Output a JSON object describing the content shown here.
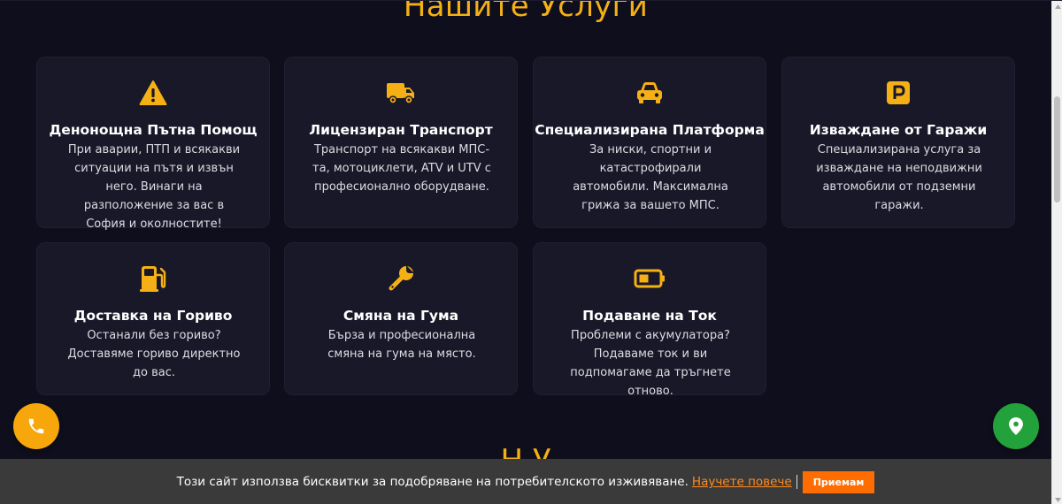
{
  "services": {
    "heading": "Нашите Услуги",
    "cards": [
      {
        "icon": "warning-triangle-icon",
        "title": "Денонощна Пътна Помощ",
        "description": "При аварии, ПТП и всякакви ситуации на пътя и извън него. Винаги на разположение за вас в София и околностите!"
      },
      {
        "icon": "truck-icon",
        "title": "Лицензиран Транспорт",
        "description": "Транспорт на всякакви МПС-та, мотоциклети, ATV и UTV с професионално оборудване."
      },
      {
        "icon": "car-icon",
        "title": "Специализирана Платформа",
        "description": "За ниски, спортни и катастрофирали автомобили. Максимална грижа за вашето МПС."
      },
      {
        "icon": "parking-icon",
        "title": "Изваждане от Гаражи",
        "description": "Специализирана услуга за изваждане на неподвижни автомобили от подземни гаражи."
      },
      {
        "icon": "gas-pump-icon",
        "title": "Доставка на Гориво",
        "description": "Останали без гориво? Доставяме гориво директно до вас."
      },
      {
        "icon": "wrench-icon",
        "title": "Смяна на Гума",
        "description": "Бърза и професионална смяна на гума на място."
      },
      {
        "icon": "battery-icon",
        "title": "Подаване на Ток",
        "description": "Проблеми с акумулатора? Подаваме ток и ви подпомагаме да тръгнете отново."
      }
    ]
  },
  "next_section": {
    "heading_partial": "Н     У"
  },
  "floating": {
    "phone_icon": "phone-icon",
    "map_icon": "map-marker-icon"
  },
  "cookie": {
    "message": "Този сайт използва бисквитки за подобряване на потребителското изживяване.",
    "learn_more": "Научете повече",
    "accept": "Приемам"
  },
  "colors": {
    "accent": "#f5b015",
    "background": "#0f0e1c",
    "card": "#191828",
    "phone_button": "#f7a70b",
    "map_button": "#23a13a",
    "cookie_bar": "#3a3a3a",
    "accept_button": "#ff6d00"
  }
}
